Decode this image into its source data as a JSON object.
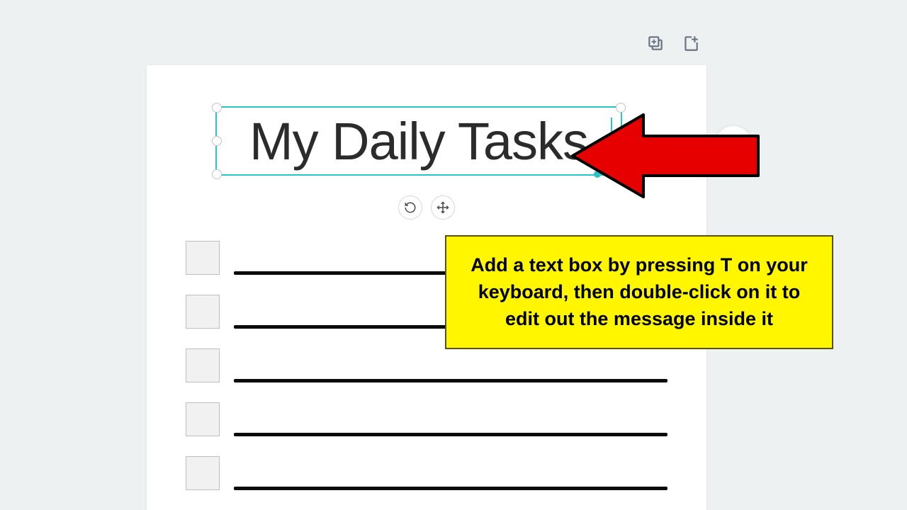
{
  "textbox": {
    "content": "My Daily Tasks"
  },
  "tooltip": {
    "message": "Add a text box by pressing T on your keyboard, then double-click on it to edit out the message inside it"
  },
  "checklist": {
    "rows": [
      0,
      1,
      2,
      3,
      4
    ]
  }
}
